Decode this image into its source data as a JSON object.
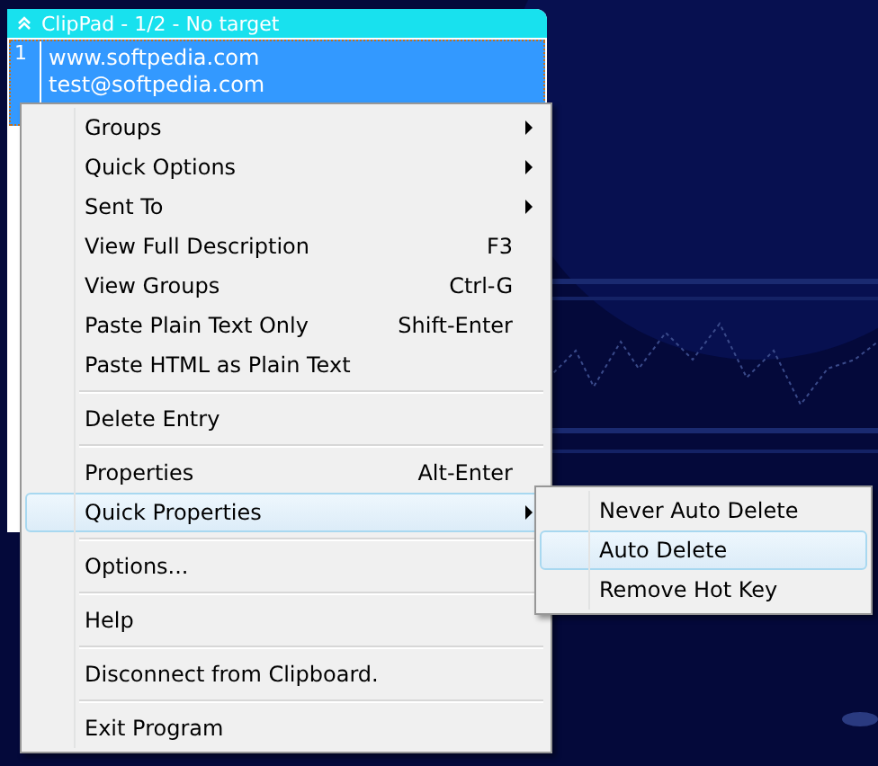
{
  "window": {
    "title": "ClipPad - 1/2 - No target"
  },
  "entries": [
    {
      "number": "1",
      "lines": [
        "www.softpedia.com",
        "test@softpedia.com"
      ],
      "selected": true
    }
  ],
  "context_menu": [
    {
      "kind": "item",
      "label": "Groups",
      "submenu": true,
      "selected": false
    },
    {
      "kind": "item",
      "label": "Quick Options",
      "submenu": true,
      "selected": false
    },
    {
      "kind": "item",
      "label": "Sent To",
      "submenu": true,
      "selected": false
    },
    {
      "kind": "item",
      "label": "View Full Description",
      "shortcut": "F3",
      "selected": false
    },
    {
      "kind": "item",
      "label": "View Groups",
      "shortcut": "Ctrl-G",
      "selected": false
    },
    {
      "kind": "item",
      "label": "Paste Plain Text Only",
      "shortcut": "Shift-Enter",
      "selected": false
    },
    {
      "kind": "item",
      "label": "Paste HTML as Plain Text",
      "selected": false
    },
    {
      "kind": "separator"
    },
    {
      "kind": "item",
      "label": "Delete Entry",
      "selected": false
    },
    {
      "kind": "separator"
    },
    {
      "kind": "item",
      "label": "Properties",
      "shortcut": "Alt-Enter",
      "selected": false
    },
    {
      "kind": "item",
      "label": "Quick Properties",
      "submenu": true,
      "selected": true
    },
    {
      "kind": "separator"
    },
    {
      "kind": "item",
      "label": "Options...",
      "selected": false
    },
    {
      "kind": "separator"
    },
    {
      "kind": "item",
      "label": "Help",
      "selected": false
    },
    {
      "kind": "separator"
    },
    {
      "kind": "item",
      "label": "Disconnect from Clipboard.",
      "selected": false
    },
    {
      "kind": "separator"
    },
    {
      "kind": "item",
      "label": "Exit Program",
      "selected": false
    }
  ],
  "submenu": [
    {
      "label": "Never Auto Delete",
      "selected": false
    },
    {
      "label": "Auto Delete",
      "selected": true
    },
    {
      "label": "Remove Hot Key",
      "selected": false
    }
  ]
}
